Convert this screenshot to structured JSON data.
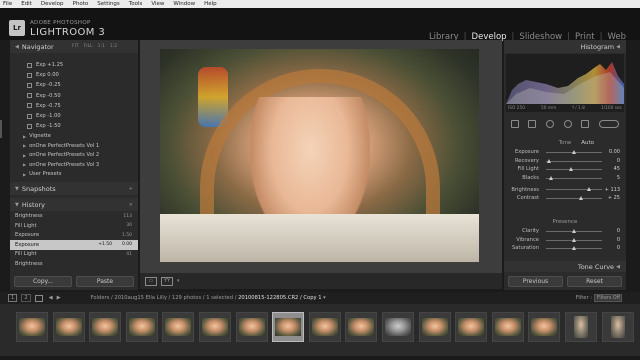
{
  "menu": [
    "File",
    "Edit",
    "Develop",
    "Photo",
    "Settings",
    "Tools",
    "View",
    "Window",
    "Help"
  ],
  "brand": {
    "logo": "Lr",
    "line1": "ADOBE PHOTOSHOP",
    "line2": "LIGHTROOM 3"
  },
  "modules": [
    "Library",
    "Develop",
    "Slideshow",
    "Print",
    "Web"
  ],
  "left_panel": {
    "navigator": {
      "title": "Navigator",
      "zooms": [
        "FIT",
        "FILL",
        "1:1",
        "1:2"
      ]
    },
    "presets": [
      "Exp +1.25",
      "Exp 0.00",
      "Exp -0.25",
      "Exp -0.50",
      "Exp -0.75",
      "Exp -1.00",
      "Exp -1.50"
    ],
    "folders": [
      "Vignette",
      "onOne PerfectPresets Vol 1",
      "onOne PerfectPresets Vol 2",
      "onOne PerfectPresets Vol 3",
      "User Presets"
    ],
    "snapshots": {
      "title": "Snapshots",
      "action": "+"
    },
    "history": {
      "title": "History",
      "action": "×",
      "items": [
        {
          "label": "Brightness",
          "a": "",
          "b": "113"
        },
        {
          "label": "Fill Light",
          "a": "",
          "b": "30"
        },
        {
          "label": "Exposure",
          "a": "",
          "b": "1.50"
        },
        {
          "label": "Exposure",
          "a": "+1.50",
          "b": "0.00"
        },
        {
          "label": "Fill Light",
          "a": "",
          "b": "41"
        },
        {
          "label": "Brightness",
          "a": "",
          "b": ""
        }
      ],
      "selected_index": 3
    },
    "buttons": {
      "copy": "Copy...",
      "paste": "Paste"
    }
  },
  "right_panel": {
    "histogram_title": "Histogram",
    "histogram_info": [
      "ISO 250",
      "50 mm",
      "f / 1.8",
      "1/100 sec"
    ],
    "tone": {
      "title": "Tone",
      "auto": "Auto",
      "sliders": [
        {
          "label": "Exposure",
          "value": "0.00",
          "pos": 0.5
        },
        {
          "label": "Recovery",
          "value": "0",
          "pos": 0.05
        },
        {
          "label": "Fill Light",
          "value": "45",
          "pos": 0.45
        },
        {
          "label": "Blacks",
          "value": "5",
          "pos": 0.1
        }
      ]
    },
    "tone2": {
      "sliders": [
        {
          "label": "Brightness",
          "value": "+ 113",
          "pos": 0.78
        },
        {
          "label": "Contrast",
          "value": "+ 25",
          "pos": 0.62
        }
      ]
    },
    "presence": {
      "title": "Presence",
      "sliders": [
        {
          "label": "Clarity",
          "value": "0",
          "pos": 0.5
        },
        {
          "label": "Vibrance",
          "value": "0",
          "pos": 0.5
        },
        {
          "label": "Saturation",
          "value": "0",
          "pos": 0.5
        }
      ]
    },
    "tone_curve": "Tone Curve",
    "buttons": {
      "previous": "Previous",
      "reset": "Reset"
    }
  },
  "filmstrip": {
    "pages": [
      "1",
      "2"
    ],
    "path_prefix": "Folders / 2010aug15 Ella Lilly / 129 photos / 1 selected /",
    "file": "20100815-122805.CR2 / Copy 1",
    "filter_label": "Filter :",
    "filter_value": "Filters Off",
    "thumbs": [
      "std",
      "std",
      "std",
      "std",
      "std",
      "std",
      "std",
      "sel",
      "std",
      "std",
      "grey",
      "std",
      "std",
      "std",
      "std",
      "tall",
      "tall"
    ]
  }
}
